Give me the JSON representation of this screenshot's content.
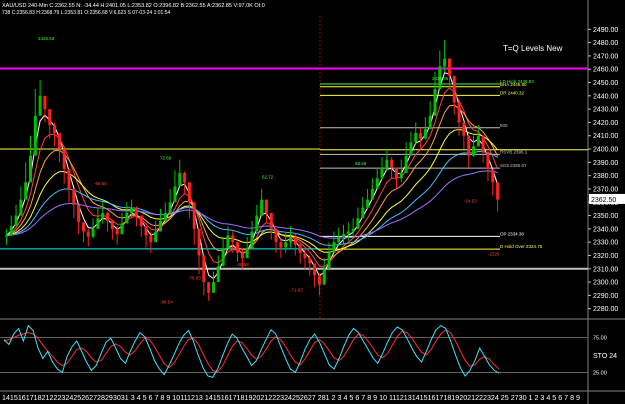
{
  "header": {
    "line1": "XAU/USD 240-Min  C:2362.55  N: -34.44  H:2401.05  L:2353.82  O:2396.82  B:2362.55  A:2362.85  V:97.0K  OI:0",
    "line2": "738  C:2356.83  H:2368.79  L:2353.81  O:2356.68  V:6,623  S  07-03-24 1:01:54"
  },
  "colors": {
    "background": "#000000",
    "candle_up": "#00c000",
    "candle_down": "#ff2020",
    "magenta_level": "#ff00ff",
    "yellow_level": "#ffff40",
    "cyan_level": "#00ffff",
    "grey_level": "#c0c0c0",
    "price_tag": "#ffffff",
    "osc_fast": "#40e0ff",
    "osc_slow": "#ff3030"
  },
  "chart_data": {
    "type": "candlestick",
    "title": "T=Q Levels New",
    "symbol": "XAU/USD",
    "interval": "240-Min",
    "ylim": [
      2273,
      2500
    ],
    "y_ticks": [
      2280,
      2290,
      2300,
      2310,
      2320,
      2330,
      2340,
      2350,
      2360,
      2370,
      2380,
      2390,
      2400,
      2410,
      2420,
      2430,
      2440,
      2450,
      2460,
      2470,
      2480,
      2490
    ],
    "y_tick_labels": [
      "2280.00",
      "2290.00",
      "2300.00",
      "2310.00",
      "2320.00",
      "2330.00",
      "2340.00",
      "2350.00",
      "2360.00",
      "2370.00",
      "2380.00",
      "2390.00",
      "2400.00",
      "2410.00",
      "2420.00",
      "2430.00",
      "2440.00",
      "2450.00",
      "2460.00",
      "2470.00",
      "2480.00",
      "2490.00"
    ],
    "x_labels": [
      "141516171819202122232425262728293031",
      "3",
      "4",
      "5",
      "6",
      "7",
      "8",
      "9",
      "10",
      "11",
      "12",
      "13",
      "14",
      "15",
      "16",
      "17",
      "18",
      "19",
      "20",
      "21",
      "22",
      "23",
      "24",
      "25",
      "26",
      "27",
      "28",
      "1",
      "2",
      "3",
      "4",
      "5",
      "6",
      "7",
      "8",
      "9",
      "10",
      "11",
      "12",
      "13",
      "14",
      "15",
      "16",
      "17",
      "18",
      "19",
      "20",
      "21",
      "22",
      "23",
      "24",
      "25",
      "27",
      "30",
      "1",
      "2",
      "3",
      "4",
      "5",
      "6",
      "7",
      "8",
      "9"
    ],
    "x_axis_text": "14151617182122232425262728293031  3 4 5 6 7 8 9 10111213 1415161718192021222324252627 281  2 3 4 5 6 7 8 9 10 1112131415161718192021222324 25  2730  1 2 3 4 5 6 7 8 9",
    "last_price": 2362.5,
    "last_price_label": "2362.50",
    "close_series": [
      2335,
      2342,
      2350,
      2362,
      2375,
      2395,
      2425,
      2440,
      2430,
      2418,
      2412,
      2400,
      2385,
      2370,
      2358,
      2345,
      2338,
      2334,
      2340,
      2348,
      2352,
      2346,
      2340,
      2336,
      2344,
      2352,
      2356,
      2350,
      2342,
      2335,
      2330,
      2338,
      2346,
      2352,
      2360,
      2372,
      2382,
      2375,
      2360,
      2340,
      2320,
      2300,
      2292,
      2300,
      2312,
      2325,
      2335,
      2330,
      2322,
      2318,
      2325,
      2338,
      2350,
      2362,
      2352,
      2340,
      2330,
      2326,
      2330,
      2334,
      2328,
      2322,
      2318,
      2314,
      2305,
      2298,
      2310,
      2322,
      2330,
      2334,
      2336,
      2338,
      2340,
      2348,
      2356,
      2362,
      2370,
      2378,
      2385,
      2392,
      2386,
      2378,
      2382,
      2395,
      2405,
      2412,
      2408,
      2415,
      2425,
      2445,
      2462,
      2468,
      2455,
      2435,
      2420,
      2410,
      2395,
      2402,
      2410,
      2398,
      2385,
      2375,
      2362
    ],
    "high_series": [
      2340,
      2350,
      2358,
      2372,
      2390,
      2410,
      2445,
      2452,
      2440,
      2428,
      2420,
      2410,
      2395,
      2380,
      2366,
      2352,
      2345,
      2340,
      2348,
      2356,
      2360,
      2353,
      2347,
      2342,
      2352,
      2360,
      2362,
      2357,
      2350,
      2342,
      2338,
      2346,
      2355,
      2360,
      2370,
      2384,
      2392,
      2383,
      2368,
      2348,
      2330,
      2310,
      2300,
      2308,
      2320,
      2334,
      2342,
      2338,
      2330,
      2326,
      2334,
      2346,
      2358,
      2370,
      2360,
      2348,
      2338,
      2333,
      2338,
      2342,
      2336,
      2330,
      2325,
      2320,
      2312,
      2306,
      2318,
      2330,
      2338,
      2341,
      2343,
      2345,
      2348,
      2356,
      2364,
      2370,
      2378,
      2386,
      2394,
      2400,
      2394,
      2386,
      2392,
      2405,
      2413,
      2420,
      2416,
      2424,
      2436,
      2458,
      2474,
      2482,
      2466,
      2445,
      2430,
      2418,
      2404,
      2410,
      2418,
      2406,
      2395,
      2383,
      2372
    ],
    "low_series": [
      2328,
      2336,
      2344,
      2355,
      2368,
      2388,
      2418,
      2430,
      2420,
      2408,
      2402,
      2390,
      2374,
      2360,
      2348,
      2336,
      2330,
      2327,
      2333,
      2342,
      2344,
      2338,
      2332,
      2328,
      2338,
      2345,
      2348,
      2342,
      2334,
      2326,
      2322,
      2330,
      2338,
      2345,
      2352,
      2364,
      2372,
      2366,
      2348,
      2328,
      2306,
      2290,
      2286,
      2292,
      2305,
      2318,
      2326,
      2322,
      2315,
      2310,
      2318,
      2330,
      2342,
      2352,
      2344,
      2332,
      2322,
      2318,
      2322,
      2326,
      2320,
      2314,
      2310,
      2305,
      2296,
      2290,
      2302,
      2315,
      2322,
      2327,
      2329,
      2331,
      2333,
      2341,
      2348,
      2355,
      2362,
      2370,
      2377,
      2384,
      2378,
      2370,
      2375,
      2388,
      2397,
      2404,
      2400,
      2407,
      2417,
      2436,
      2452,
      2458,
      2445,
      2426,
      2410,
      2400,
      2386,
      2394,
      2402,
      2390,
      2376,
      2365,
      2353
    ],
    "levels": [
      {
        "price": 2460.5,
        "color": "magenta",
        "label": ""
      },
      {
        "price": 2448.93,
        "color": "green",
        "label": "LD High 2448.93"
      },
      {
        "price": 2446.8,
        "color": "yellow",
        "label": "BHA 2446.80"
      },
      {
        "price": 2440.32,
        "color": "yellow",
        "label": "DR 2440.32"
      },
      {
        "price": 2416,
        "color": "grey",
        "label": "500"
      },
      {
        "price": 2399.5,
        "color": "yellow",
        "label": ""
      },
      {
        "price": 2396.0,
        "color": "grey",
        "label": "RSVB 2396.1"
      },
      {
        "price": 2385.67,
        "color": "grey",
        "label": "SG5 2385.67"
      },
      {
        "price": 2334.38,
        "color": "white",
        "label": "OP 2334.38"
      },
      {
        "price": 2324.75,
        "color": "yellow",
        "label": "D Hold Over 2324.75"
      },
      {
        "price": 2310,
        "color": "grey",
        "label": ""
      }
    ],
    "annotations": [
      {
        "text": "2425.53",
        "price": 2482
      },
      {
        "text": "2436.85",
        "price": 2452
      },
      {
        "text": "72.69",
        "price": 2392
      },
      {
        "text": "62.72",
        "price": 2378
      },
      {
        "text": "68.28",
        "price": 2388
      },
      {
        "text": "-54.53",
        "price": 2360
      },
      {
        "text": "-66.65",
        "price": 2373
      },
      {
        "text": "-48.58",
        "price": 2312
      },
      {
        "text": "-78.83",
        "price": 2302
      },
      {
        "text": "-71.63",
        "price": 2293
      },
      {
        "text": "-96.54",
        "price": 2284
      },
      {
        "text": "-2326",
        "price": 2320
      }
    ],
    "oscillator": {
      "label": "STO",
      "value_label": "24",
      "levels": [
        75,
        25
      ],
      "level_labels": [
        "75.00",
        "25.00"
      ],
      "fast": [
        72,
        65,
        80,
        88,
        70,
        92,
        85,
        60,
        45,
        55,
        40,
        30,
        25,
        48,
        62,
        70,
        55,
        40,
        28,
        35,
        52,
        68,
        74,
        60,
        45,
        38,
        55,
        70,
        82,
        76,
        60,
        42,
        30,
        22,
        35,
        50,
        66,
        78,
        85,
        70,
        50,
        32,
        20,
        18,
        30,
        48,
        66,
        80,
        74,
        60,
        48,
        35,
        42,
        58,
        72,
        86,
        80,
        62,
        45,
        30,
        25,
        40,
        58,
        72,
        80,
        68,
        52,
        36,
        30,
        45,
        62,
        78,
        88,
        82,
        70,
        58,
        46,
        38,
        52,
        68,
        82,
        90,
        86,
        74,
        60,
        48,
        40,
        55,
        72,
        86,
        92,
        88,
        70,
        50,
        32,
        20,
        28,
        42,
        60,
        48,
        36,
        28,
        24
      ],
      "slow": [
        70,
        72,
        75,
        78,
        80,
        82,
        80,
        74,
        64,
        56,
        48,
        40,
        35,
        38,
        48,
        58,
        60,
        55,
        46,
        40,
        42,
        52,
        62,
        66,
        62,
        54,
        50,
        56,
        66,
        74,
        72,
        62,
        50,
        38,
        32,
        38,
        50,
        62,
        72,
        74,
        66,
        52,
        38,
        28,
        26,
        34,
        48,
        62,
        70,
        68,
        60,
        50,
        44,
        48,
        58,
        70,
        76,
        72,
        62,
        50,
        40,
        36,
        44,
        56,
        68,
        72,
        66,
        56,
        46,
        42,
        48,
        60,
        72,
        80,
        78,
        70,
        60,
        50,
        46,
        52,
        64,
        76,
        84,
        82,
        74,
        64,
        54,
        50,
        58,
        70,
        80,
        86,
        82,
        70,
        56,
        42,
        34,
        36,
        44,
        48,
        44,
        36,
        30
      ]
    }
  }
}
